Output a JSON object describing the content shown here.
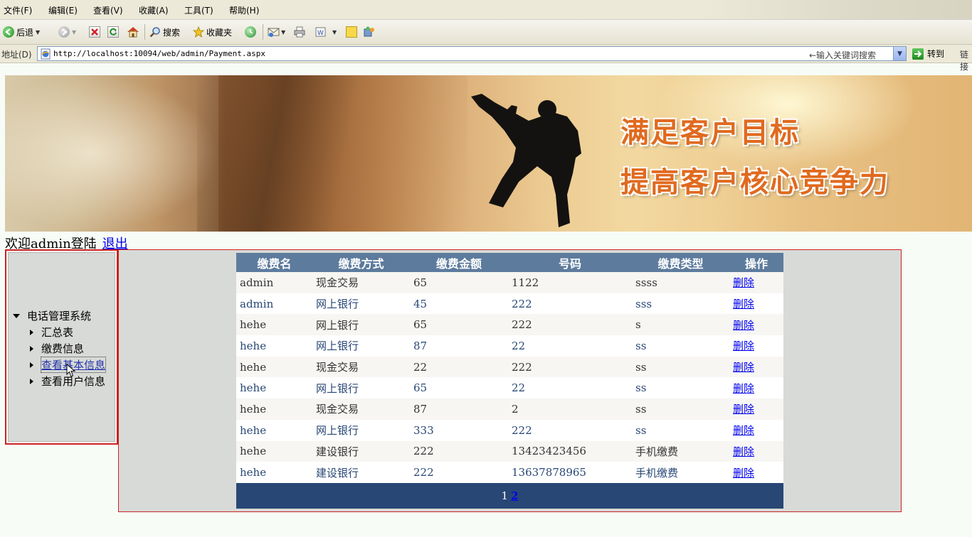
{
  "browser": {
    "menu": [
      "文件(F)",
      "编辑(E)",
      "查看(V)",
      "收藏(A)",
      "工具(T)",
      "帮助(H)"
    ],
    "toolbar": {
      "back": "后退",
      "search": "搜索",
      "favorites": "收藏夹"
    },
    "address": {
      "label": "地址(D)",
      "url": "http://localhost:10094/web/admin/Payment.aspx",
      "search_hint": "←输入关键词搜索",
      "go": "转到",
      "links": "链接"
    }
  },
  "banner": {
    "slogan1": "满足客户目标",
    "slogan2": "提高客户核心竞争力"
  },
  "welcome": {
    "text": "欢迎admin登陆",
    "logout": "退出"
  },
  "nav": {
    "root": "电话管理系统",
    "items": [
      {
        "label": "汇总表"
      },
      {
        "label": "缴费信息"
      },
      {
        "label": "查看基本信息"
      },
      {
        "label": "查看用户信息"
      }
    ]
  },
  "table": {
    "headers": [
      "缴费名",
      "缴费方式",
      "缴费金额",
      "号码",
      "缴费类型",
      "操作"
    ],
    "rows": [
      {
        "name": "admin",
        "method": "现金交易",
        "amount": "65",
        "number": "1122",
        "type": "ssss",
        "action": "删除"
      },
      {
        "name": "admin",
        "method": "网上银行",
        "amount": "45",
        "number": "222",
        "type": "sss",
        "action": "删除"
      },
      {
        "name": "hehe",
        "method": "网上银行",
        "amount": "65",
        "number": "222",
        "type": "s",
        "action": "删除"
      },
      {
        "name": "hehe",
        "method": "网上银行",
        "amount": "87",
        "number": "22",
        "type": "ss",
        "action": "删除"
      },
      {
        "name": "hehe",
        "method": "现金交易",
        "amount": "22",
        "number": "222",
        "type": "ss",
        "action": "删除"
      },
      {
        "name": "hehe",
        "method": "网上银行",
        "amount": "65",
        "number": "22",
        "type": "ss",
        "action": "删除"
      },
      {
        "name": "hehe",
        "method": "现金交易",
        "amount": "87",
        "number": "2",
        "type": "ss",
        "action": "删除"
      },
      {
        "name": "hehe",
        "method": "网上银行",
        "amount": "333",
        "number": "222",
        "type": "ss",
        "action": "删除"
      },
      {
        "name": "hehe",
        "method": "建设银行",
        "amount": "222",
        "number": "13423423456",
        "type": "手机缴费",
        "action": "删除"
      },
      {
        "name": "hehe",
        "method": "建设银行",
        "amount": "222",
        "number": "13637878965",
        "type": "手机缴费",
        "action": "删除"
      }
    ],
    "pager": {
      "current": "1",
      "other": "2"
    }
  }
}
